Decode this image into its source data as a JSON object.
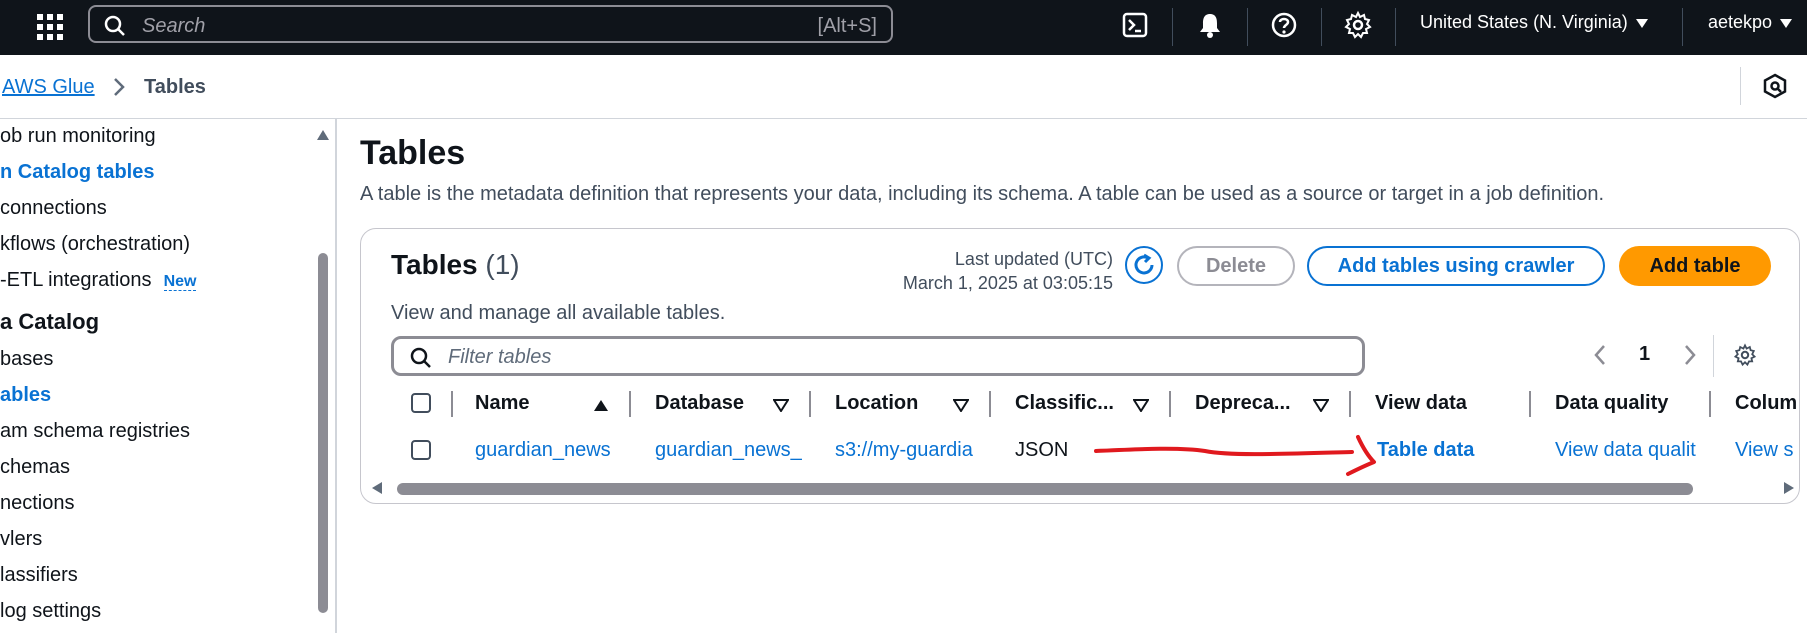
{
  "topnav": {
    "search_placeholder": "Search",
    "search_shortcut": "[Alt+S]",
    "region": "United States (N. Virginia)",
    "user": "aetekpo"
  },
  "breadcrumb": {
    "root": "AWS Glue",
    "current": "Tables"
  },
  "sidebar": {
    "items": [
      {
        "label": "ob run monitoring",
        "style": "normal"
      },
      {
        "label": "n Catalog tables",
        "style": "active"
      },
      {
        "label": "connections",
        "style": "normal"
      },
      {
        "label": "kflows (orchestration)",
        "style": "normal"
      },
      {
        "label": "-ETL integrations",
        "style": "normal",
        "badge": "New"
      },
      {
        "label": "a Catalog",
        "style": "section"
      },
      {
        "label": "bases",
        "style": "normal"
      },
      {
        "label": "ables",
        "style": "active"
      },
      {
        "label": "am schema registries",
        "style": "normal"
      },
      {
        "label": "chemas",
        "style": "normal"
      },
      {
        "label": "nections",
        "style": "normal"
      },
      {
        "label": "vlers",
        "style": "normal"
      },
      {
        "label": "lassifiers",
        "style": "normal"
      },
      {
        "label": "log settings",
        "style": "normal"
      }
    ]
  },
  "page": {
    "title": "Tables",
    "description": "A table is the metadata definition that represents your data, including its schema. A table can be used as a source or target in a job definition."
  },
  "tables_card": {
    "title": "Tables",
    "count": "(1)",
    "description": "View and manage all available tables.",
    "last_updated_label": "Last updated (UTC)",
    "last_updated_value": "March 1, 2025 at 03:05:15",
    "delete_label": "Delete",
    "add_crawler_label": "Add tables using crawler",
    "add_table_label": "Add table",
    "filter_placeholder": "Filter tables",
    "page_number": "1",
    "columns": [
      "Name",
      "Database",
      "Location",
      "Classific...",
      "Depreca...",
      "View data",
      "Data quality",
      "Colum"
    ],
    "rows": [
      {
        "name": "guardian_news",
        "database": "guardian_news_",
        "location": "s3://my-guardia",
        "classification": "JSON",
        "deprecated": "",
        "view_data": "Table data",
        "data_quality": "View data qualit",
        "column": "View s"
      }
    ]
  },
  "colors": {
    "accent": "#0972d3",
    "primary_button": "#ff9900",
    "nav_bg": "#0f141a",
    "annotation": "#e0191e"
  },
  "icons": [
    "apps-grid-icon",
    "search-icon",
    "cloudshell-icon",
    "bell-icon",
    "help-icon",
    "gear-icon",
    "refresh-icon",
    "sort-asc-icon",
    "sort-desc-icon",
    "chevron-left-icon",
    "chevron-right-icon"
  ]
}
